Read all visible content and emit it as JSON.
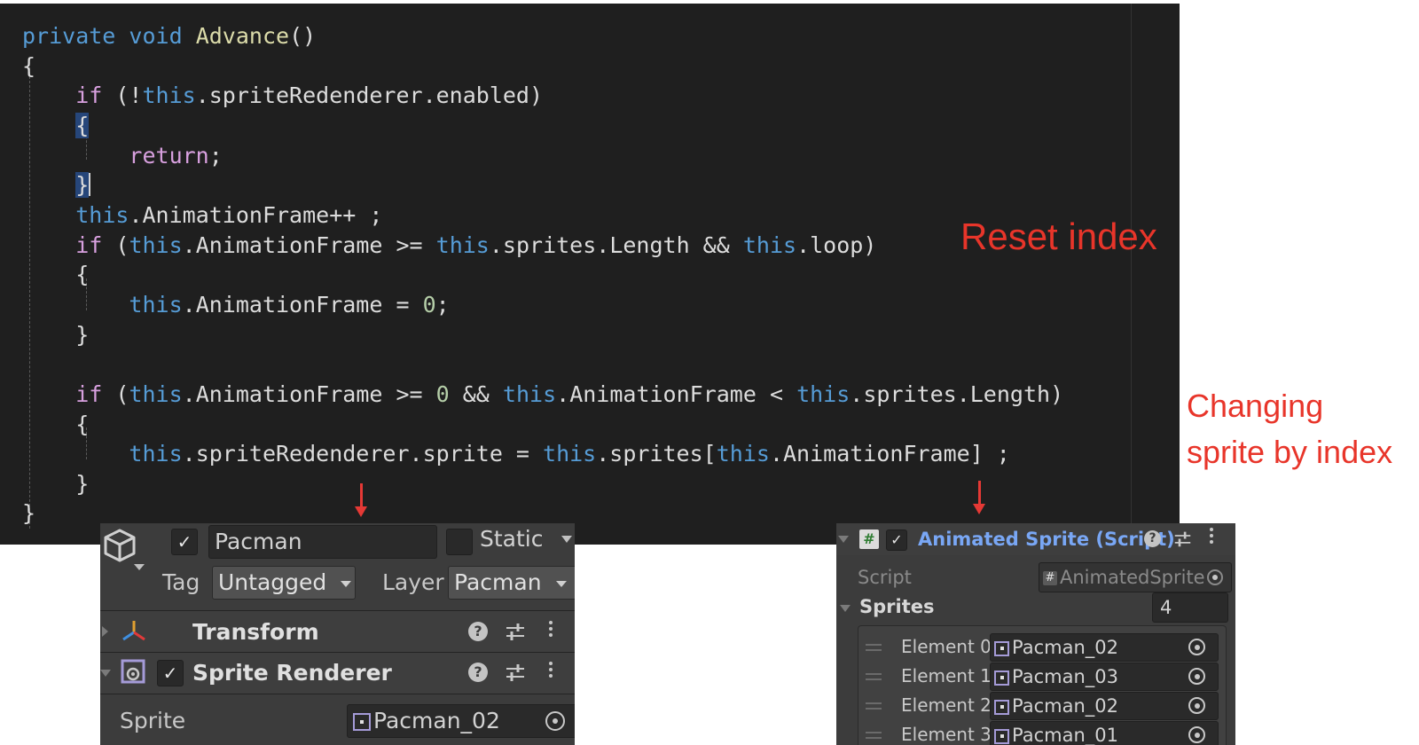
{
  "code": {
    "lines": [
      [
        {
          "c": "kw",
          "t": "private"
        },
        {
          "c": "",
          "t": " "
        },
        {
          "c": "kw",
          "t": "void"
        },
        {
          "c": "",
          "t": " "
        },
        {
          "c": "fn",
          "t": "Advance"
        },
        {
          "c": "",
          "t": "()"
        }
      ],
      [
        {
          "c": "",
          "t": "{"
        }
      ],
      [
        {
          "c": "",
          "t": "    "
        },
        {
          "c": "ctl",
          "t": "if"
        },
        {
          "c": "",
          "t": " (!"
        },
        {
          "c": "kw",
          "t": "this"
        },
        {
          "c": "",
          "t": ".spriteRedenderer.enabled)"
        }
      ],
      [
        {
          "c": "",
          "t": "    "
        },
        {
          "c": "brace-hl",
          "t": "{"
        }
      ],
      [
        {
          "c": "",
          "t": "        "
        },
        {
          "c": "ctl",
          "t": "return"
        },
        {
          "c": "",
          "t": ";"
        }
      ],
      [
        {
          "c": "",
          "t": "    "
        },
        {
          "c": "brace-hl",
          "t": "}"
        },
        {
          "c": "caret",
          "t": ""
        }
      ],
      [
        {
          "c": "",
          "t": "    "
        },
        {
          "c": "kw",
          "t": "this"
        },
        {
          "c": "",
          "t": ".AnimationFrame++ ;"
        }
      ],
      [
        {
          "c": "",
          "t": "    "
        },
        {
          "c": "ctl",
          "t": "if"
        },
        {
          "c": "",
          "t": " ("
        },
        {
          "c": "kw",
          "t": "this"
        },
        {
          "c": "",
          "t": ".AnimationFrame >= "
        },
        {
          "c": "kw",
          "t": "this"
        },
        {
          "c": "",
          "t": ".sprites.Length && "
        },
        {
          "c": "kw",
          "t": "this"
        },
        {
          "c": "",
          "t": ".loop)"
        }
      ],
      [
        {
          "c": "",
          "t": "    {"
        }
      ],
      [
        {
          "c": "",
          "t": "        "
        },
        {
          "c": "kw",
          "t": "this"
        },
        {
          "c": "",
          "t": ".AnimationFrame = "
        },
        {
          "c": "num",
          "t": "0"
        },
        {
          "c": "",
          "t": ";"
        }
      ],
      [
        {
          "c": "",
          "t": "    }"
        }
      ],
      [
        {
          "c": "",
          "t": ""
        }
      ],
      [
        {
          "c": "",
          "t": "    "
        },
        {
          "c": "ctl",
          "t": "if"
        },
        {
          "c": "",
          "t": " ("
        },
        {
          "c": "kw",
          "t": "this"
        },
        {
          "c": "",
          "t": ".AnimationFrame >= "
        },
        {
          "c": "num",
          "t": "0"
        },
        {
          "c": "",
          "t": " && "
        },
        {
          "c": "kw",
          "t": "this"
        },
        {
          "c": "",
          "t": ".AnimationFrame < "
        },
        {
          "c": "kw",
          "t": "this"
        },
        {
          "c": "",
          "t": ".sprites.Length)"
        }
      ],
      [
        {
          "c": "",
          "t": "    {"
        }
      ],
      [
        {
          "c": "",
          "t": "        "
        },
        {
          "c": "kw",
          "t": "this"
        },
        {
          "c": "",
          "t": ".spriteRedenderer.sprite = "
        },
        {
          "c": "kw",
          "t": "this"
        },
        {
          "c": "",
          "t": ".sprites["
        },
        {
          "c": "kw",
          "t": "this"
        },
        {
          "c": "",
          "t": ".AnimationFrame] ;"
        }
      ],
      [
        {
          "c": "",
          "t": "    }"
        }
      ],
      [
        {
          "c": "",
          "t": "}"
        }
      ]
    ]
  },
  "annotations": {
    "reset_index": "Reset index",
    "changing_sprite_line1": "Changing",
    "changing_sprite_line2": "sprite by index"
  },
  "game_object_panel": {
    "name": "Pacman",
    "static_label": "Static",
    "tag_label": "Tag",
    "tag_value": "Untagged",
    "layer_label": "Layer",
    "layer_value": "Pacman",
    "transform_label": "Transform",
    "sprite_renderer_label": "Sprite Renderer",
    "sprite_label": "Sprite",
    "sprite_value": "Pacman_02"
  },
  "animated_sprite_panel": {
    "title": "Animated Sprite (Script)",
    "script_label": "Script",
    "script_value": "AnimatedSprite",
    "sprites_label": "Sprites",
    "sprites_count": "4",
    "elements": [
      {
        "label": "Element 0",
        "value": "Pacman_02"
      },
      {
        "label": "Element 1",
        "value": "Pacman_03"
      },
      {
        "label": "Element 2",
        "value": "Pacman_02"
      },
      {
        "label": "Element 3",
        "value": "Pacman_01"
      }
    ]
  },
  "colors": {
    "editor_bg": "#1f1f1f",
    "keyword": "#569cd6",
    "control": "#d8a0df",
    "method": "#dcdcaa",
    "number": "#b5cea8",
    "annotation": "#e8352a",
    "panel_bg": "#3c3c3c",
    "script_title": "#79a7f5"
  }
}
